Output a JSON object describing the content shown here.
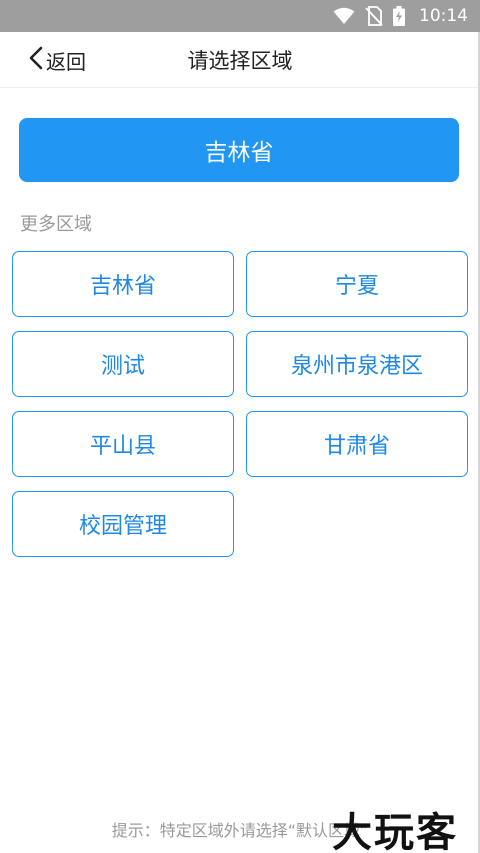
{
  "status_bar": {
    "time": "10:14",
    "icons": [
      "wifi-icon",
      "no-sim-icon",
      "battery-charging-icon"
    ]
  },
  "nav": {
    "back_label": "返回",
    "title": "请选择区域"
  },
  "current_region": "吉林省",
  "section_label": "更多区域",
  "regions": [
    "吉林省",
    "宁夏",
    "测试",
    "泉州市泉港区",
    "平山县",
    "甘肃省",
    "校园管理"
  ],
  "hint": "提示：特定区域外请选择“默认区域”",
  "watermark": "大玩客",
  "colors": {
    "accent": "#2196f3",
    "status_bar": "#9e9e9e",
    "muted_text": "#9a9a9a"
  }
}
